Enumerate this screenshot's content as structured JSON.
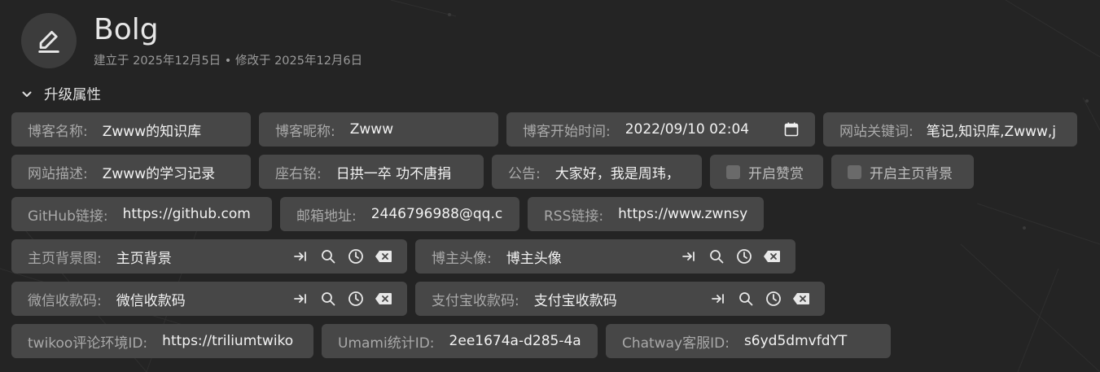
{
  "note": {
    "title": "Bolg",
    "meta": "建立于 2025年12月5日 • 修改于 2025年12月6日"
  },
  "section": {
    "label": "升级属性"
  },
  "attributes": {
    "blog_name": {
      "label": "博客名称:",
      "value": "Zwww的知识库"
    },
    "blog_nickname": {
      "label": "博客昵称:",
      "value": "Zwww"
    },
    "blog_start_time": {
      "label": "博客开始时间:",
      "value": "2022/09/10 02:04"
    },
    "site_keywords": {
      "label": "网站关键词:",
      "value": "笔记,知识库,Zwww,j"
    },
    "site_description": {
      "label": "网站描述:",
      "value": "Zwww的学习记录"
    },
    "motto": {
      "label": "座右铭:",
      "value": "日拱一卒 功不唐捐"
    },
    "notice": {
      "label": "公告:",
      "value": "大家好，我是周玮，"
    },
    "enable_reward": {
      "label": "开启赞赏"
    },
    "enable_home_bg": {
      "label": "开启主页背景"
    },
    "github_link": {
      "label": "GitHub链接:",
      "value": "https://github.com"
    },
    "email": {
      "label": "邮箱地址:",
      "value": "2446796988@qq.c"
    },
    "rss_link": {
      "label": "RSS链接:",
      "value": "https://www.zwnsy"
    },
    "home_bg_image": {
      "label": "主页背景图:",
      "value": "主页背景"
    },
    "blogger_avatar": {
      "label": "博主头像:",
      "value": "博主头像"
    },
    "wechat_qr": {
      "label": "微信收款码:",
      "value": "微信收款码"
    },
    "alipay_qr": {
      "label": "支付宝收款码:",
      "value": "支付宝收款码"
    },
    "twikoo_id": {
      "label": "twikoo评论环境ID:",
      "value": "https://triliumtwiko"
    },
    "umami_id": {
      "label": "Umami统计ID:",
      "value": "2ee1674a-d285-4a"
    },
    "chatway_id": {
      "label": "Chatway客服ID:",
      "value": "s6yd5dmvfdYT"
    }
  },
  "icons": {
    "avatar": "edit-pencil-icon",
    "section_toggle": "chevron-down-icon",
    "calendar": "calendar-icon",
    "link_tools": [
      "go-to-icon",
      "search-icon",
      "history-icon",
      "clear-icon"
    ]
  },
  "colors": {
    "background": "#242424",
    "chip": "#474747",
    "label": "#a9a9a9",
    "value": "#f2f2f2"
  }
}
